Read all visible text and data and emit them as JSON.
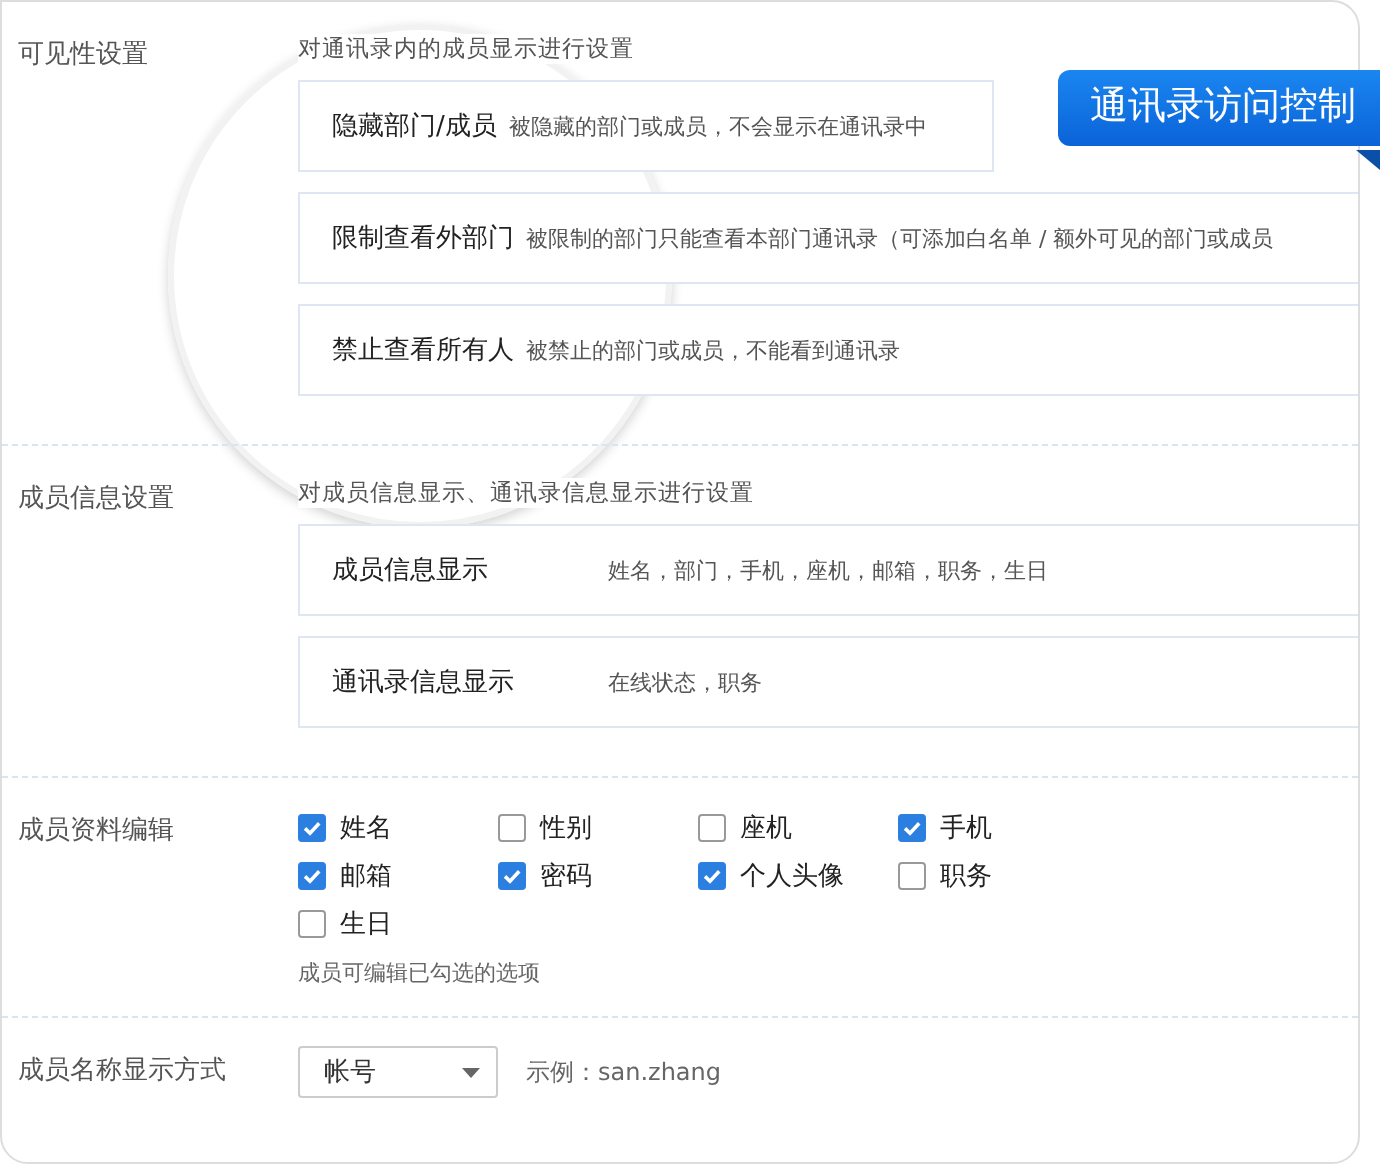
{
  "sections": [
    {
      "kind": "options",
      "label": "可见性设置",
      "description": "对通讯录内的成员显示进行设置",
      "items": [
        {
          "title": "隐藏部门/成员",
          "detail": "被隐藏的部门或成员，不会显示在通讯录中"
        },
        {
          "title": "限制查看外部门",
          "detail": "被限制的部门只能查看本部门通讯录（可添加白名单 / 额外可见的部门或成员"
        },
        {
          "title": "禁止查看所有人",
          "detail": "被禁止的部门或成员，不能看到通讯录"
        }
      ]
    },
    {
      "kind": "options",
      "label": "成员信息设置",
      "description": "对成员信息显示、通讯录信息显示进行设置",
      "items": [
        {
          "title": "成员信息显示",
          "detail": "姓名，部门，手机，座机，邮箱，职务，生日"
        },
        {
          "title": "通讯录信息显示",
          "detail": "在线状态，职务"
        }
      ]
    },
    {
      "kind": "checkboxes",
      "label": "成员资料编辑",
      "items": [
        {
          "label": "姓名",
          "checked": true
        },
        {
          "label": "性别",
          "checked": false
        },
        {
          "label": "座机",
          "checked": false
        },
        {
          "label": "手机",
          "checked": true
        },
        {
          "label": "邮箱",
          "checked": true
        },
        {
          "label": "密码",
          "checked": true
        },
        {
          "label": "个人头像",
          "checked": true
        },
        {
          "label": "职务",
          "checked": false
        },
        {
          "label": "生日",
          "checked": false
        }
      ],
      "note": "成员可编辑已勾选的选项"
    },
    {
      "kind": "select",
      "label": "成员名称显示方式",
      "value": "帐号",
      "example": "示例：san.zhang"
    }
  ],
  "badge": "通讯录访问控制"
}
